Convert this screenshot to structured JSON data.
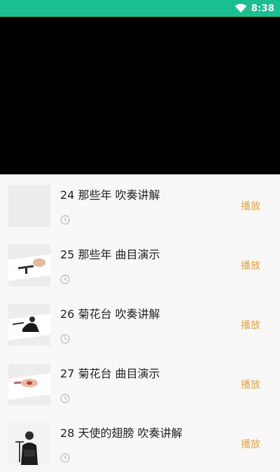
{
  "status_bar": {
    "time": "8:38",
    "background": "#1bbf8f"
  },
  "accent": "#e0a546",
  "lessons": [
    {
      "title": "24 那些年 吹奏讲解",
      "play_label": "播放",
      "thumbnail": "blank-thumbnail"
    },
    {
      "title": "25 那些年 曲目演示",
      "play_label": "播放",
      "thumbnail": "hand-instrument-thumbnail"
    },
    {
      "title": "26 菊花台 吹奏讲解",
      "play_label": "播放",
      "thumbnail": "player-thumbnail"
    },
    {
      "title": "27 菊花台 曲目演示",
      "play_label": "播放",
      "thumbnail": "closeup-thumbnail"
    },
    {
      "title": "28 天使的翅膀 吹奏讲解",
      "play_label": "播放",
      "thumbnail": "performer-thumbnail"
    }
  ]
}
